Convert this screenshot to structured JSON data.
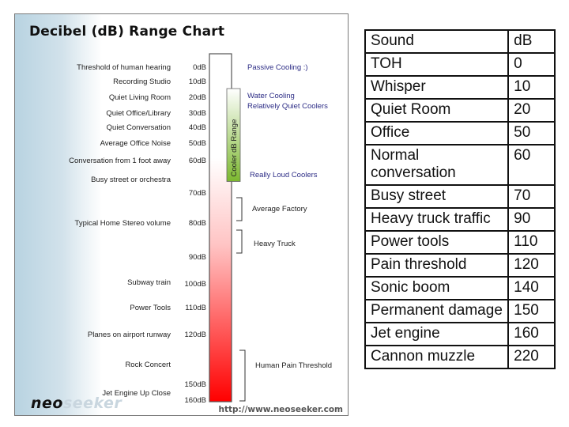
{
  "chart_data": {
    "type": "bar",
    "title": "Decibel (dB) Range Chart",
    "ylabel": "dB",
    "ylim": [
      0,
      160
    ],
    "axis_ticks": [
      "0dB",
      "10dB",
      "20dB",
      "30dB",
      "40dB",
      "50dB",
      "60dB",
      "70dB",
      "80dB",
      "90dB",
      "100dB",
      "110dB",
      "120dB",
      "150dB",
      "160dB"
    ],
    "axis_tick_values": [
      0,
      10,
      20,
      30,
      40,
      50,
      60,
      70,
      80,
      90,
      100,
      110,
      120,
      150,
      160
    ],
    "sound_labels": [
      {
        "label": "Threshold of human hearing",
        "db": 0
      },
      {
        "label": "Recording Studio",
        "db": 10
      },
      {
        "label": "Quiet Living Room",
        "db": 20
      },
      {
        "label": "Quiet Office/Library",
        "db": 30
      },
      {
        "label": "Quiet Conversation",
        "db": 40
      },
      {
        "label": "Average Office Noise",
        "db": 50
      },
      {
        "label": "Conversation from 1 foot away",
        "db": 60
      },
      {
        "label": "Busy street or orchestra",
        "db": 65
      },
      {
        "label": "Typical Home Stereo volume",
        "db": 80
      },
      {
        "label": "Subway train",
        "db": 100
      },
      {
        "label": "Power Tools",
        "db": 110
      },
      {
        "label": "Planes on airport runway",
        "db": 120
      },
      {
        "label": "Rock Concert",
        "db": 140
      },
      {
        "label": "Jet Engine Up Close",
        "db": 155
      }
    ],
    "cooler_range": {
      "label": "Cooler dB Range",
      "from_db": 20,
      "to_db": 65,
      "color": "#8bc34a"
    },
    "cooler_labels": [
      {
        "label": "Passive Cooling :)",
        "db": 0
      },
      {
        "label": "Water Cooling",
        "db": 20
      },
      {
        "label": "Relatively Quiet Coolers",
        "db": 25
      },
      {
        "label": "Really Loud Coolers",
        "db": 63
      }
    ],
    "range_annotations": [
      {
        "label": "Average Factory",
        "from_db": 71,
        "to_db": 79
      },
      {
        "label": "Heavy Truck",
        "from_db": 82,
        "to_db": 90
      },
      {
        "label": "Human Pain Threshold",
        "from_db": 130,
        "to_db": 160
      }
    ],
    "bar_gradient": {
      "top_color": "#ffffff",
      "bottom_color": "#ff0000"
    }
  },
  "branding": {
    "logo_neo": "neo",
    "logo_seeker": "seeker",
    "url": "http://www.neoseeker.com"
  },
  "table": {
    "headers": [
      "Sound",
      "dB"
    ],
    "rows": [
      [
        "TOH",
        "0"
      ],
      [
        "Whisper",
        "10"
      ],
      [
        "Quiet Room",
        "20"
      ],
      [
        "Office",
        "50"
      ],
      [
        "Normal conversation",
        "60"
      ],
      [
        "Busy street",
        "70"
      ],
      [
        "Heavy truck traffic",
        "90"
      ],
      [
        "Power tools",
        "110"
      ],
      [
        "Pain threshold",
        "120"
      ],
      [
        "Sonic boom",
        "140"
      ],
      [
        "Permanent damage",
        "150"
      ],
      [
        "Jet engine",
        "160"
      ],
      [
        "Cannon muzzle",
        "220"
      ]
    ]
  }
}
